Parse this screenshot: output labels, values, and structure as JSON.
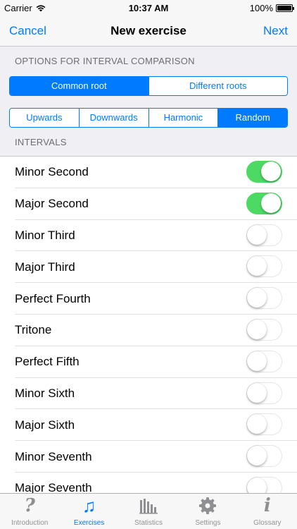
{
  "status": {
    "carrier": "Carrier",
    "time": "10:37 AM",
    "battery": "100%"
  },
  "nav": {
    "cancel": "Cancel",
    "title": "New exercise",
    "next": "Next"
  },
  "options_header": "OPTIONS FOR INTERVAL COMPARISON",
  "root_segments": [
    {
      "label": "Common root",
      "selected": true
    },
    {
      "label": "Different roots",
      "selected": false
    }
  ],
  "direction_segments": [
    {
      "label": "Upwards",
      "selected": false
    },
    {
      "label": "Downwards",
      "selected": false
    },
    {
      "label": "Harmonic",
      "selected": false
    },
    {
      "label": "Random",
      "selected": true
    }
  ],
  "intervals_header": "INTERVALS",
  "intervals": [
    {
      "label": "Minor Second",
      "on": true
    },
    {
      "label": "Major Second",
      "on": true
    },
    {
      "label": "Minor Third",
      "on": false
    },
    {
      "label": "Major Third",
      "on": false
    },
    {
      "label": "Perfect Fourth",
      "on": false
    },
    {
      "label": "Tritone",
      "on": false
    },
    {
      "label": "Perfect Fifth",
      "on": false
    },
    {
      "label": "Minor Sixth",
      "on": false
    },
    {
      "label": "Major Sixth",
      "on": false
    },
    {
      "label": "Minor Seventh",
      "on": false
    },
    {
      "label": "Major Seventh",
      "on": false
    }
  ],
  "tabs": [
    {
      "label": "Introduction",
      "icon": "question-icon",
      "active": false
    },
    {
      "label": "Exercises",
      "icon": "music-note-icon",
      "active": true
    },
    {
      "label": "Statistics",
      "icon": "bar-chart-icon",
      "active": false
    },
    {
      "label": "Settings",
      "icon": "gear-icon",
      "active": false
    },
    {
      "label": "Glossary",
      "icon": "info-icon",
      "active": false
    }
  ],
  "colors": {
    "accent": "#007aff",
    "toggle_on": "#4cd964",
    "background": "#efeff4"
  }
}
